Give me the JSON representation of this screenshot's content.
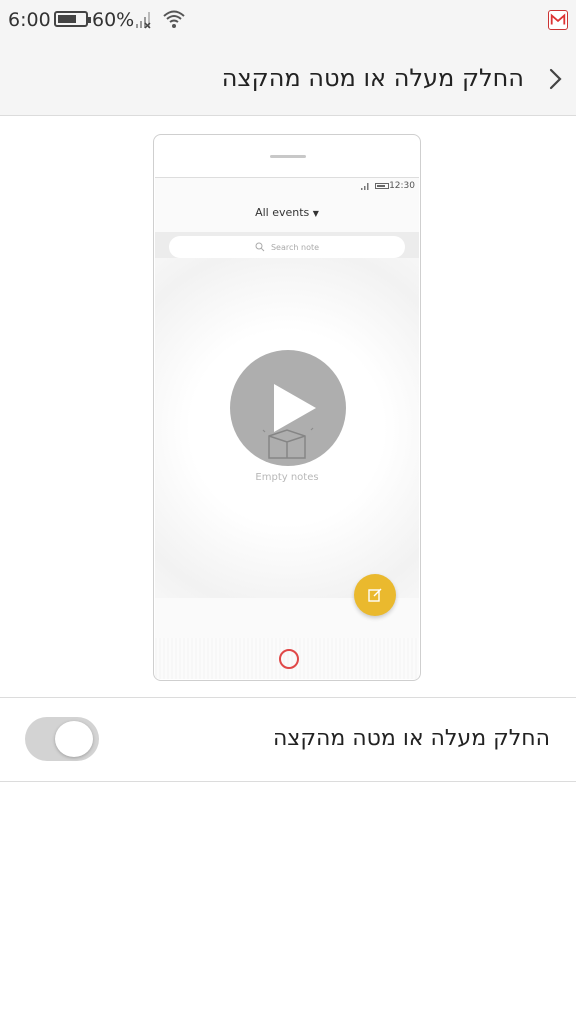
{
  "status_bar": {
    "time": "6:00",
    "battery_percent": "60%",
    "battery_level": 0.6,
    "icons": [
      "battery-icon",
      "signal-icon",
      "wifi-icon",
      "gmail-icon"
    ]
  },
  "header": {
    "title": "החלק מעלה או מטה מהקצה",
    "back_icon": "chevron-right-icon"
  },
  "preview": {
    "screen_time": "12:30",
    "title": "All events",
    "search_placeholder": "Search note",
    "empty_label": "Empty notes",
    "fab_icon": "edit-note-icon",
    "play_icon": "play-icon",
    "colors": {
      "fab": "#eab92e",
      "home_button": "#e04848"
    }
  },
  "setting": {
    "label": "החלק מעלה או מטה מהקצה",
    "enabled": false
  }
}
